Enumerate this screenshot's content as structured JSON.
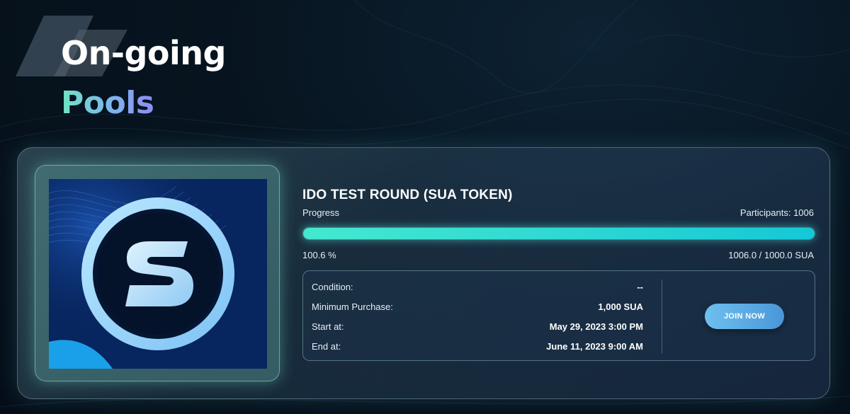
{
  "heading": {
    "line1": "On-going",
    "line2": "Pools"
  },
  "pool": {
    "title": "IDO TEST ROUND (SUA TOKEN)",
    "progress_label": "Progress",
    "participants": "Participants: 1006",
    "progress_fraction": 1.0,
    "progress_percent": "100.6 %",
    "raised_amount": "1006.0 / 1000.0 SUA",
    "token_logo_icon": "sua-s-logo-icon",
    "details": [
      {
        "label": "Condition:",
        "value": "--"
      },
      {
        "label": "Minimum Purchase:",
        "value": "1,000 SUA"
      },
      {
        "label": "Start at:",
        "value": "May 29, 2023 3:00 PM"
      },
      {
        "label": "End at:",
        "value": "June 11, 2023 9:00 AM"
      }
    ],
    "join_label": "JOIN NOW"
  },
  "colors": {
    "accent_teal": "#45e8cf",
    "accent_blue": "#4a96d8",
    "pools_gradient_start": "#6fe3c4",
    "pools_gradient_end": "#8d8cf2",
    "background": "#050e18"
  }
}
